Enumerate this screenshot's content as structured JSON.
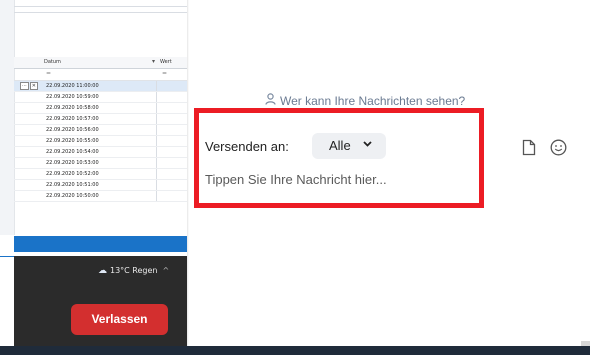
{
  "spreadsheet": {
    "columns": {
      "datum": "Datum",
      "wert": "Wert"
    },
    "filter_symbols": {
      "datum": "=",
      "wert": "="
    },
    "row_icons": [
      "···",
      "✕"
    ],
    "rows": [
      "22.09.2020 11:00:00",
      "22.09.2020 10:59:00",
      "22.09.2020 10:58:00",
      "22.09.2020 10:57:00",
      "22.09.2020 10:56:00",
      "22.09.2020 10:55:00",
      "22.09.2020 10:54:00",
      "22.09.2020 10:53:00",
      "22.09.2020 10:52:00",
      "22.09.2020 10:51:00",
      "22.09.2020 10:50:00"
    ]
  },
  "taskbar": {
    "weather_text": "13°C  Regen",
    "weather_icon": "cloud-rain-icon",
    "chevron": "^"
  },
  "meeting": {
    "leave_label": "Verlassen",
    "leave_color": "#d32f2f"
  },
  "chat": {
    "visibility_text": "Wer kann Ihre Nachrichten sehen?",
    "send_to_label": "Versenden an:",
    "recipient_value": "Alle",
    "message_placeholder": "Tippen Sie Ihre Nachricht hier...",
    "file_icon": "file-icon",
    "emoji_icon": "emoji-icon"
  },
  "annotation": {
    "highlight_color": "#ec1c24"
  }
}
